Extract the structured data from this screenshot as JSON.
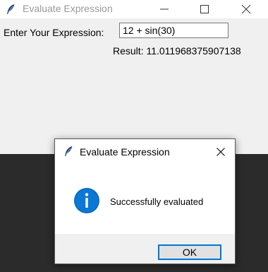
{
  "main_window": {
    "title": "Evaluate Expression",
    "expression_label": "Enter Your Expression:",
    "expression_value": "12 + sin(30)",
    "result_text": "Result: 11.011968375907138"
  },
  "dialog": {
    "title": "Evaluate Expression",
    "message": "Successfully evaluated",
    "ok_label": "OK",
    "icon": "info-icon"
  },
  "colors": {
    "window_bg": "#f0f0f0",
    "desktop_bg": "#2b2b2b",
    "info_blue": "#0a78d4",
    "focus_border": "#0078d7"
  }
}
